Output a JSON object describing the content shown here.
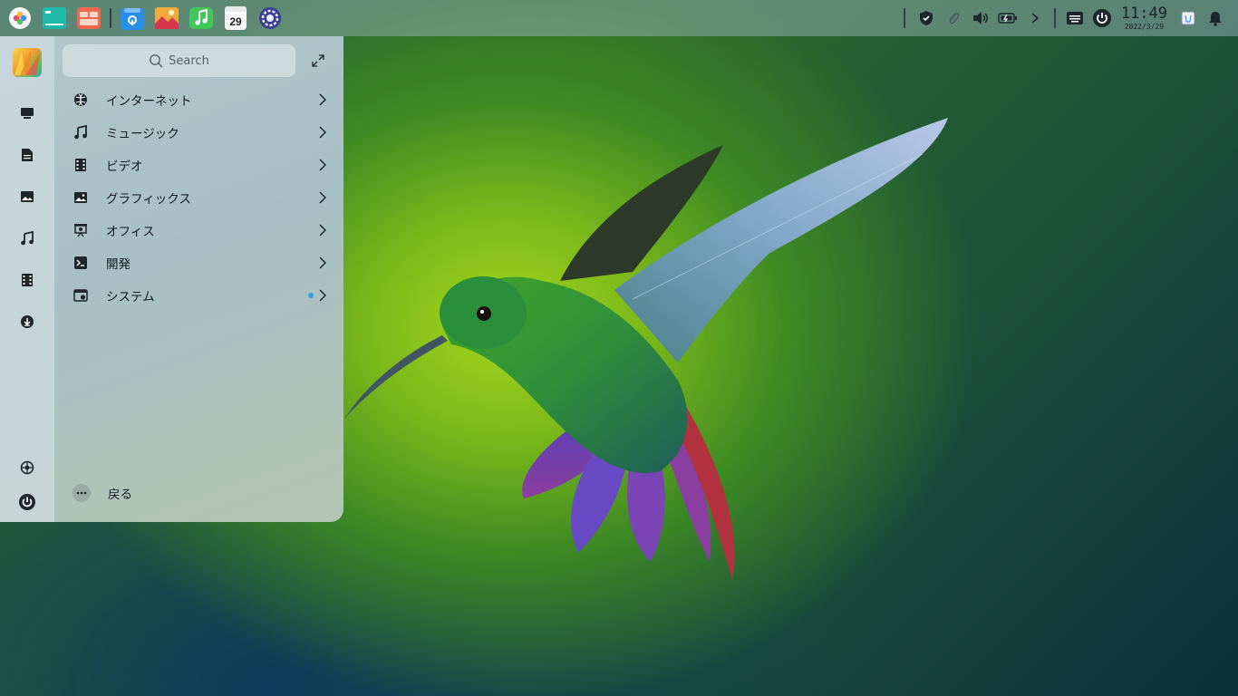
{
  "taskbar": {
    "apps": [
      {
        "name": "launcher",
        "icon": "launcher-icon"
      },
      {
        "name": "terminal",
        "icon": "terminal-icon"
      },
      {
        "name": "file-manager",
        "icon": "file-manager-icon"
      },
      {
        "name": "app-store",
        "icon": "app-store-icon"
      },
      {
        "name": "image-viewer",
        "icon": "image-viewer-icon"
      },
      {
        "name": "music",
        "icon": "music-icon"
      },
      {
        "name": "calendar",
        "icon": "calendar-icon",
        "badge": "29"
      },
      {
        "name": "settings",
        "icon": "settings-icon"
      }
    ],
    "tray": [
      "shield-icon",
      "clip-icon",
      "volume-icon",
      "battery-icon",
      "expand-tray-icon",
      "keyboard-icon",
      "power-icon"
    ],
    "clock": {
      "time": "11:49",
      "date": "2022/3/29"
    },
    "trash_icon": "trash-icon",
    "notifications_icon": "bell-icon"
  },
  "start_menu": {
    "search": {
      "placeholder": "Search"
    },
    "rail": [
      "computer-icon",
      "document-icon",
      "picture-icon",
      "music-icon",
      "video-icon",
      "download-icon"
    ],
    "rail_bottom": [
      "settings-icon",
      "power-icon"
    ],
    "categories": [
      {
        "label": "インターネット",
        "icon": "globe-icon"
      },
      {
        "label": "ミュージック",
        "icon": "music-note-icon"
      },
      {
        "label": "ビデオ",
        "icon": "film-icon"
      },
      {
        "label": "グラフィックス",
        "icon": "image-icon"
      },
      {
        "label": "オフィス",
        "icon": "presentation-icon"
      },
      {
        "label": "開発",
        "icon": "terminal-prompt-icon"
      },
      {
        "label": "システム",
        "icon": "system-icon",
        "has_update_dot": true
      }
    ],
    "back_label": "戻る"
  },
  "colors": {
    "accent": "#3b9cf0",
    "text": "#111a20"
  }
}
